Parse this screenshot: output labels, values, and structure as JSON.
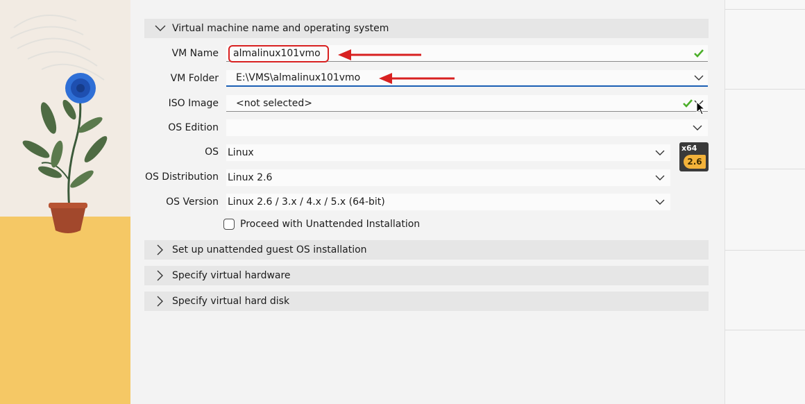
{
  "sections": {
    "name_os": "Virtual machine name and operating system",
    "unattended": "Set up unattended guest OS installation",
    "hardware": "Specify virtual hardware",
    "hard_disk": "Specify virtual hard disk"
  },
  "form": {
    "vm_name_label": "VM Name",
    "vm_name_value": "almalinux101vmo",
    "vm_folder_label": "VM Folder",
    "vm_folder_value": "E:\\VMS\\almalinux101vmo",
    "iso_label": "ISO Image",
    "iso_value": "<not selected>",
    "edition_label": "OS Edition",
    "edition_value": "",
    "os_label": "OS",
    "os_value": "Linux",
    "distro_label": "OS Distribution",
    "distro_value": "Linux 2.6",
    "version_label": "OS Version",
    "version_value": "Linux 2.6 / 3.x / 4.x / 5.x (64-bit)",
    "unattended_checkbox": "Proceed with Unattended Installation",
    "unattended_checked": false
  },
  "os_badge": {
    "arch": "x64",
    "version": "2.6"
  },
  "icons": {
    "valid": "checkmark-icon",
    "dropdown": "chevron-down-icon",
    "expanded": "chevron-down-icon",
    "collapsed": "chevron-right-icon",
    "pointer": "mouse-cursor-icon"
  },
  "colors": {
    "accent": "#1a5fb4",
    "valid_check": "#4caf2a",
    "annotation": "#d82020",
    "section_bg": "#e6e6e6"
  }
}
